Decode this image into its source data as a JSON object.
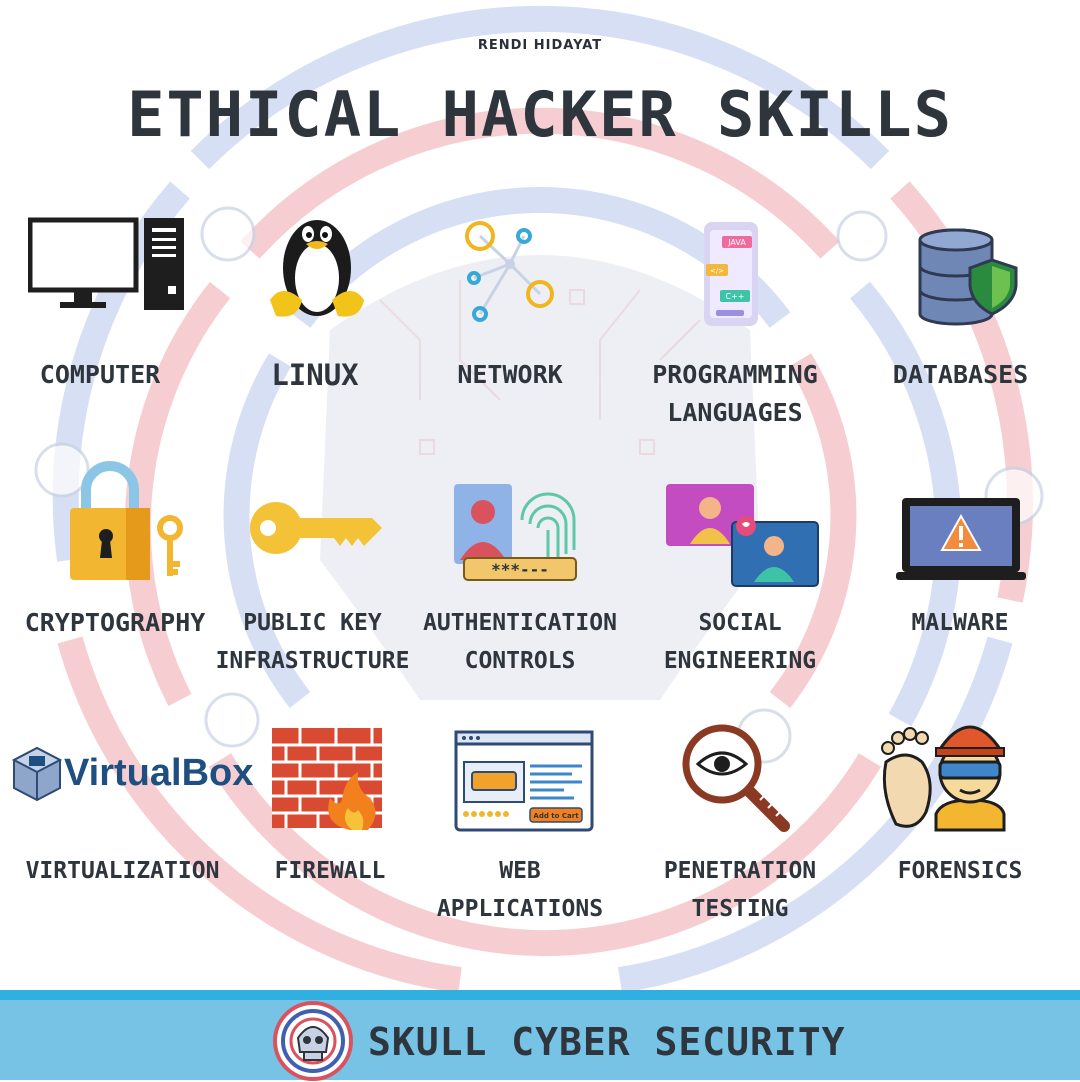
{
  "header": {
    "author": "RENDI HIDAYAT",
    "title": "ETHICAL HACKER SKILLS"
  },
  "skills": {
    "computer": "COMPUTER",
    "linux": "LINUX",
    "network": "NETWORK",
    "programming": "PROGRAMMING\nLANGUAGES",
    "databases": "DATABASES",
    "cryptography": "CRYPTOGRAPHY",
    "pki": "PUBLIC KEY\nINFRASTRUCTURE",
    "auth": "AUTHENTICATION\nCONTROLS",
    "social": "SOCIAL\nENGINEERING",
    "malware": "MALWARE",
    "virtualization": "VIRTUALIZATION",
    "firewall": "FIREWALL",
    "webapps": "WEB\nAPPLICATIONS",
    "pentest": "PENETRATION\nTESTING",
    "forensics": "FORENSICS"
  },
  "icon_text": {
    "virtualbox": "VirtualBox",
    "java": "JAVA",
    "cpp": "C++",
    "code_tag": "</>",
    "add_to_cart": "Add to Cart",
    "password_mask": "***---"
  },
  "footer": {
    "brand": "SKULL CYBER SECURITY"
  },
  "colors": {
    "accent_blue": "#77c3e6",
    "ring_red": "#f0a7ae",
    "ring_blue": "#b8c6ec",
    "text": "#2f353d"
  }
}
